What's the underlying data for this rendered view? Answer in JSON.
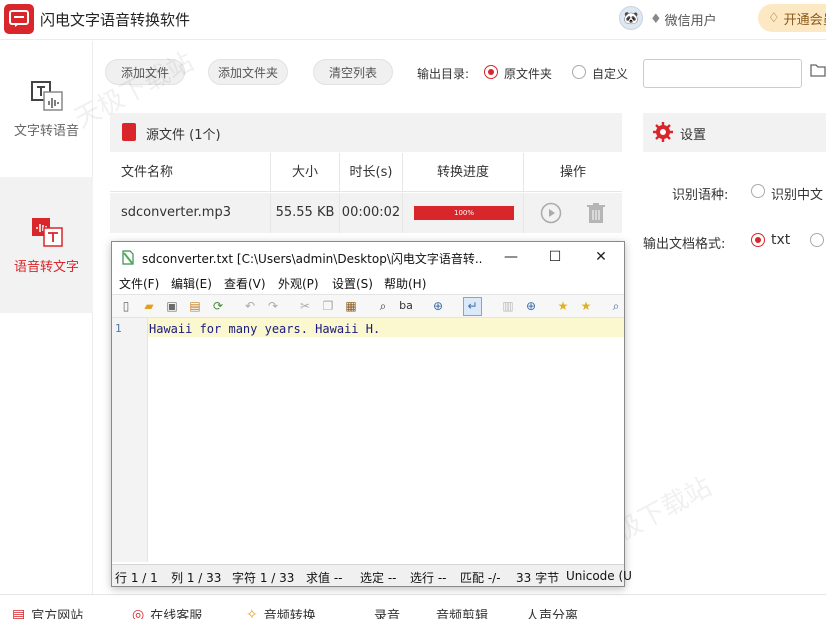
{
  "app": {
    "title": "闪电文字语音转换软件",
    "user": "微信用户",
    "vip_button": "开通会员",
    "accent": "#d9262b"
  },
  "sidebar": {
    "items": [
      {
        "label": "文字转语音",
        "icon": "text-to-speech-icon",
        "active": false
      },
      {
        "label": "语音转文字",
        "icon": "speech-to-text-icon",
        "active": true
      }
    ]
  },
  "toolbar": {
    "add_file": "添加文件",
    "add_folder": "添加文件夹",
    "clear_list": "清空列表",
    "output_dir_label": "输出目录:",
    "opt_source_folder": "原文件夹",
    "opt_custom": "自定义",
    "output_dir_value": ""
  },
  "source_panel": {
    "title": "源文件 (1个)",
    "columns": [
      "文件名称",
      "大小",
      "时长(s)",
      "转换进度",
      "操作"
    ],
    "rows": [
      {
        "name": "sdconverter.mp3",
        "size": "55.55 KB",
        "duration": "00:00:02",
        "progress_label": "100%",
        "progress": 100
      }
    ]
  },
  "settings": {
    "title": "设置",
    "lang_label": "识别语种:",
    "lang_option": "识别中文",
    "format_label": "输出文档格式:",
    "format_option": "txt"
  },
  "bottom": {
    "items": [
      "官方网站",
      "在线客服",
      "音频转换",
      "录音",
      "音频剪辑",
      "人声分离"
    ]
  },
  "watermark": [
    "天极下载站",
    "天极下载站"
  ],
  "notepad": {
    "title": "sdconverter.txt [C:\\Users\\admin\\Desktop\\闪电文字语音转...",
    "menu": [
      "文件(F)",
      "编辑(E)",
      "查看(V)",
      "外观(P)",
      "设置(S)",
      "帮助(H)"
    ],
    "line_no": "1",
    "text": "Hawaii for many years. Hawaii H.",
    "status": [
      "行 1 / 1",
      "列 1 / 33",
      "字符 1 / 33",
      "求值 --",
      "选定 --",
      "选行 --",
      "匹配 -/-",
      "33 字节",
      "Unicode (U"
    ]
  }
}
